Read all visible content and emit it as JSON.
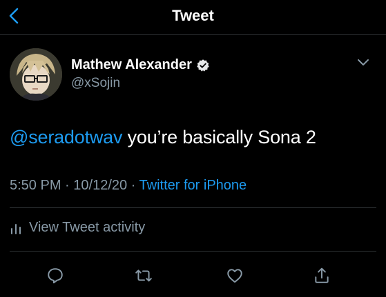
{
  "header": {
    "title": "Tweet",
    "back_icon": "chevron-left-icon"
  },
  "author": {
    "name": "Mathew Alexander",
    "handle": "@xSojin",
    "verified": true,
    "avatar_icon": "avatar-anime-glasses"
  },
  "tweet": {
    "mention": "@seradotwav",
    "text": " you’re basically Sona 2"
  },
  "meta": {
    "time": "5:50 PM",
    "separator1": " · ",
    "date": "10/12/20",
    "separator2": " · ",
    "source": "Twitter for iPhone"
  },
  "activity": {
    "label": "View Tweet activity",
    "icon": "bar-chart-icon"
  },
  "actions": [
    {
      "name": "reply",
      "icon": "reply-icon"
    },
    {
      "name": "retweet",
      "icon": "retweet-icon"
    },
    {
      "name": "like",
      "icon": "heart-icon"
    },
    {
      "name": "share",
      "icon": "share-icon"
    }
  ],
  "colors": {
    "background": "#000000",
    "accent": "#1d9bf0",
    "muted": "#8899a6",
    "divider": "#2f3336"
  }
}
